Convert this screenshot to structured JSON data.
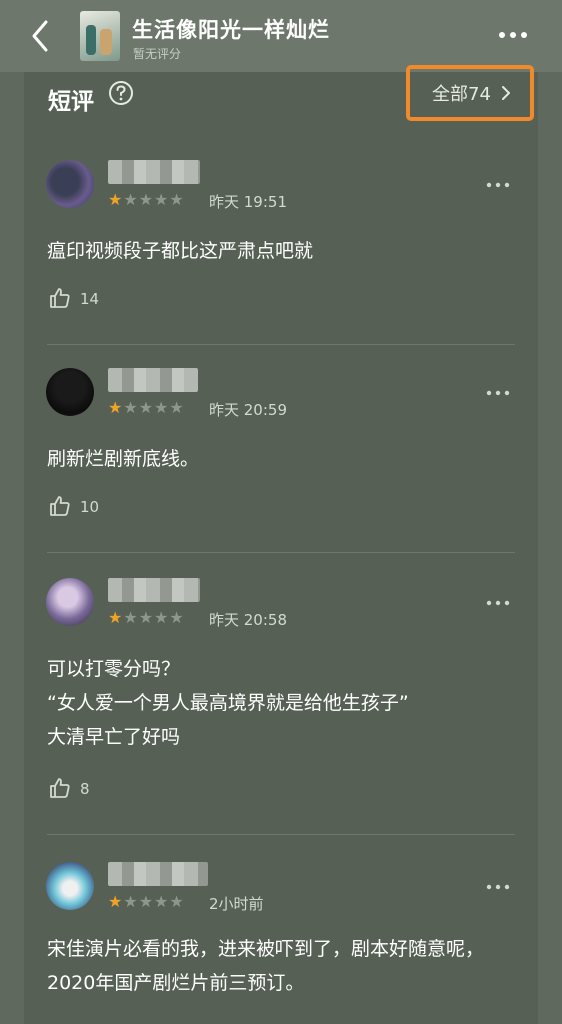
{
  "header": {
    "title": "生活像阳光一样灿烂",
    "subtitle": "暂无评分"
  },
  "section": {
    "title": "短评",
    "all_label": "全部74"
  },
  "reviews": [
    {
      "rating": 1,
      "max_rating": 5,
      "time": "昨天 19:51",
      "text": "瘟印视频段子都比这严肃点吧就",
      "likes": "14"
    },
    {
      "rating": 1,
      "max_rating": 5,
      "time": "昨天 20:59",
      "text": "刷新烂剧新底线。",
      "likes": "10"
    },
    {
      "rating": 1,
      "max_rating": 5,
      "time": "昨天 20:58",
      "text": "可以打零分吗？\n“女人爱一个男人最高境界就是给他生孩子”\n大清早亡了好吗",
      "likes": "8"
    },
    {
      "rating": 1,
      "max_rating": 5,
      "time": "2小时前",
      "text": "宋佳演片必看的我，进来被吓到了，剧本好随意呢，2020年国产剧烂片前三预订。"
    }
  ],
  "colors": {
    "star_active": "#f1a229",
    "highlight_border": "#f08a2a"
  }
}
